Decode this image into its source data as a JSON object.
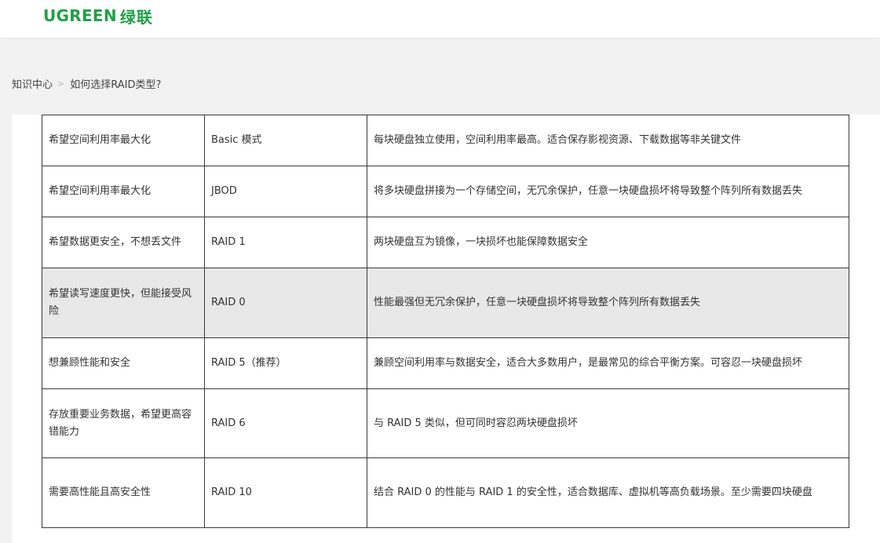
{
  "header": {
    "logo_text": "UGREEN",
    "logo_cn": "绿联"
  },
  "breadcrumb": {
    "items": [
      "知识中心",
      "如何选择RAID类型?"
    ],
    "separator": ">"
  },
  "table": {
    "rows": [
      {
        "need": "希望空间利用率最大化",
        "mode": "Basic 模式",
        "desc": "每块硬盘独立使用，空间利用率最高。适合保存影视资源、下载数据等非关键文件"
      },
      {
        "need": "希望空间利用率最大化",
        "mode": "JBOD",
        "desc": "将多块硬盘拼接为一个存储空间，无冗余保护，任意一块硬盘损坏将导致整个阵列所有数据丢失"
      },
      {
        "need": "希望数据更安全，不想丢文件",
        "mode": "RAID 1",
        "desc": "两块硬盘互为镜像，一块损坏也能保障数据安全"
      },
      {
        "need": "希望读写速度更快，但能接受风险",
        "mode": "RAID 0",
        "desc": "性能最强但无冗余保护，任意一块硬盘损坏将导致整个阵列所有数据丢失"
      },
      {
        "need": "想兼顾性能和安全",
        "mode": "RAID 5（推荐）",
        "desc": "兼顾空间利用率与数据安全，适合大多数用户，是最常见的综合平衡方案。可容忍一块硬盘损坏"
      },
      {
        "need": "存放重要业务数据，希望更高容错能力",
        "mode": "RAID 6",
        "desc": "与 RAID 5 类似，但可同时容忍两块硬盘损坏"
      },
      {
        "need": "需要高性能且高安全性",
        "mode": "RAID 10",
        "desc": "结合 RAID 0 的性能与 RAID 1 的安全性，适合数据库、虚拟机等高负载场景。至少需要四块硬盘"
      }
    ]
  },
  "colors": {
    "brand": "#20a047",
    "highlight_row": "#e8e8e8"
  }
}
